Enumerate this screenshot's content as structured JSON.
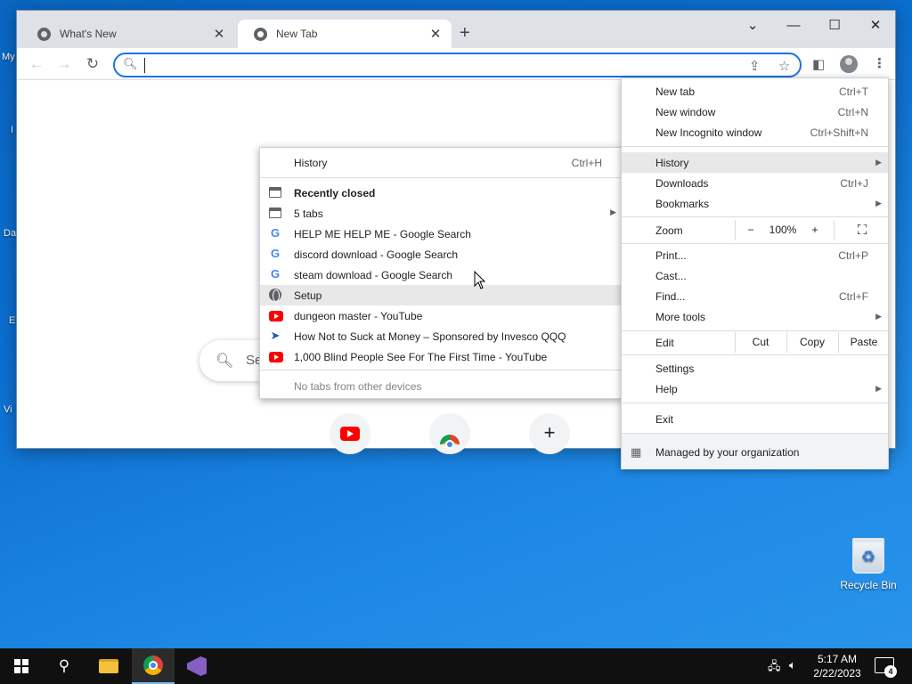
{
  "desktop": {
    "left_icons": [
      "My",
      "I",
      "Da",
      "E",
      "Vi"
    ],
    "recycle_bin_label": "Recycle Bin"
  },
  "browser": {
    "tabs": [
      {
        "title": "What's New",
        "active": false
      },
      {
        "title": "New Tab",
        "active": true
      }
    ],
    "new_tab_plus": "+",
    "window_controls": {
      "dropdown": "⌄",
      "minimize": "—",
      "maximize": "☐",
      "close": "✕"
    },
    "omnibox": {
      "value": "",
      "placeholder": ""
    },
    "ntp": {
      "search_placeholder_visible": "Se"
    }
  },
  "main_menu": {
    "items": [
      {
        "label": "New tab",
        "shortcut": "Ctrl+T"
      },
      {
        "label": "New window",
        "shortcut": "Ctrl+N"
      },
      {
        "label": "New Incognito window",
        "shortcut": "Ctrl+Shift+N"
      },
      {
        "label": "History",
        "shortcut": ""
      },
      {
        "label": "Downloads",
        "shortcut": "Ctrl+J"
      },
      {
        "label": "Bookmarks",
        "shortcut": ""
      },
      {
        "label": "Print...",
        "shortcut": "Ctrl+P"
      },
      {
        "label": "Cast...",
        "shortcut": ""
      },
      {
        "label": "Find...",
        "shortcut": "Ctrl+F"
      },
      {
        "label": "More tools",
        "shortcut": ""
      },
      {
        "label": "Settings",
        "shortcut": ""
      },
      {
        "label": "Help",
        "shortcut": ""
      },
      {
        "label": "Exit",
        "shortcut": ""
      }
    ],
    "zoom": {
      "label": "Zoom",
      "minus": "−",
      "value": "100%",
      "plus": "+"
    },
    "edit": {
      "label": "Edit",
      "cut": "Cut",
      "copy": "Copy",
      "paste": "Paste"
    },
    "managed": "Managed by your organization"
  },
  "history_submenu": {
    "history": {
      "label": "History",
      "shortcut": "Ctrl+H"
    },
    "recently_closed_heading": "Recently closed",
    "entries": [
      {
        "label": "5 tabs",
        "icon": "window-icon"
      },
      {
        "label": "HELP ME HELP ME - Google Search",
        "icon": "google-icon"
      },
      {
        "label": "discord download - Google Search",
        "icon": "google-icon"
      },
      {
        "label": "steam download - Google Search",
        "icon": "google-icon"
      },
      {
        "label": "Setup",
        "icon": "globe-icon"
      },
      {
        "label": "dungeon master - YouTube",
        "icon": "youtube-icon"
      },
      {
        "label": "How Not to Suck at Money – Sponsored by Invesco QQQ",
        "icon": "invesco-icon"
      },
      {
        "label": "1,000 Blind People See For The First Time - YouTube",
        "icon": "youtube-icon"
      }
    ],
    "no_other_devices": "No tabs from other devices"
  },
  "taskbar": {
    "time": "5:17 AM",
    "date": "2/22/2023",
    "notifications_count": "4"
  },
  "colors": {
    "desktop_blue": "#0b6fd0",
    "accent": "#1a73e8",
    "taskbar": "#101010"
  }
}
